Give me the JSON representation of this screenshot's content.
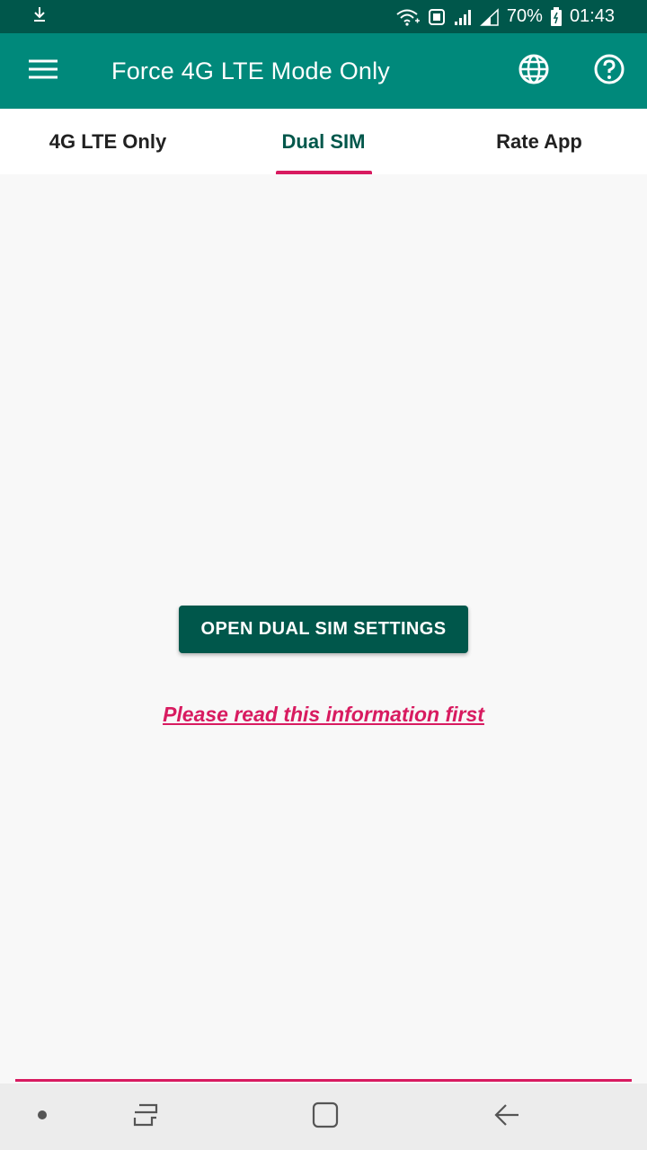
{
  "status_bar": {
    "battery": "70%",
    "time": "01:43"
  },
  "app_bar": {
    "title": "Force 4G LTE Mode Only"
  },
  "tabs": [
    {
      "label": "4G LTE Only",
      "active": false
    },
    {
      "label": "Dual SIM",
      "active": true
    },
    {
      "label": "Rate App",
      "active": false
    }
  ],
  "content": {
    "button_label": "OPEN DUAL SIM SETTINGS",
    "info_link": "Please read this information first"
  },
  "icons": {
    "status_left": "download-icon",
    "status_right": [
      "wifi-icon",
      "hd-volte-icon",
      "signal-icon",
      "signal-icon",
      "battery-icon"
    ],
    "app_bar_left": "hamburger-menu-icon",
    "app_bar_actions": [
      "globe-icon",
      "help-icon"
    ],
    "nav": [
      "dot-icon",
      "recent-apps-icon",
      "home-icon",
      "back-icon"
    ]
  },
  "colors": {
    "status_bar": "#00574b",
    "app_bar": "#00897b",
    "accent": "#d81b60",
    "button": "#00574b",
    "active_tab_text": "#00574b"
  }
}
